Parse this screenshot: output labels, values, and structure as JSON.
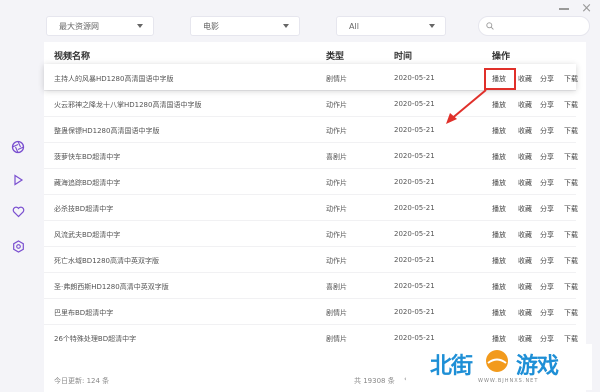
{
  "window": {
    "minimize_icon": "minus-icon",
    "close_label": "×"
  },
  "sidebar": {
    "icons": [
      "aperture-icon",
      "play-icon",
      "heart-icon",
      "settings-icon"
    ],
    "accent": "#7a4fd0"
  },
  "filters": {
    "source": "最大资源网",
    "category": "电影",
    "region": "All",
    "search_placeholder": ""
  },
  "table": {
    "headers": {
      "name": "视频名称",
      "type": "类型",
      "time": "时间",
      "actions": "操作"
    },
    "action_labels": {
      "play": "播放",
      "favorite": "收藏",
      "share": "分享",
      "download": "下载"
    },
    "rows": [
      {
        "name": "主持人的风暴HD1280高清国语中字版",
        "type": "剧情片",
        "time": "2020-05-21"
      },
      {
        "name": "火云邪神之降龙十八掌HD1280高清国语中字版",
        "type": "动作片",
        "time": "2020-05-21"
      },
      {
        "name": "整蛊保镖HD1280高清国语中字版",
        "type": "动作片",
        "time": "2020-05-21"
      },
      {
        "name": "菠萝快车BD超清中字",
        "type": "喜剧片",
        "time": "2020-05-21"
      },
      {
        "name": "藏海追踪BD超清中字",
        "type": "动作片",
        "time": "2020-05-21"
      },
      {
        "name": "必杀技BD超清中字",
        "type": "动作片",
        "time": "2020-05-21"
      },
      {
        "name": "风流武夫BD超清中字",
        "type": "动作片",
        "time": "2020-05-21"
      },
      {
        "name": "死亡水域BD1280高清中英双字版",
        "type": "动作片",
        "time": "2020-05-21"
      },
      {
        "name": "圣·弗朗西斯HD1280高清中英双字版",
        "type": "喜剧片",
        "time": "2020-05-21"
      },
      {
        "name": "巴里布BD超清中字",
        "type": "剧情片",
        "time": "2020-05-21"
      },
      {
        "name": "26个特殊处理BD超清中字",
        "type": "剧情片",
        "time": "2020-05-21"
      }
    ]
  },
  "footer": {
    "today_updates": "今日更新: 124 条",
    "total": "共 19308 条",
    "pager": "‹"
  },
  "highlight": {
    "color": "#e0302a"
  },
  "watermark": {
    "left": "北街",
    "right": "游戏",
    "url": "WWW.BJHNXS.NET",
    "color": "#1e8fd6",
    "sun_color": "#f29a1c"
  }
}
